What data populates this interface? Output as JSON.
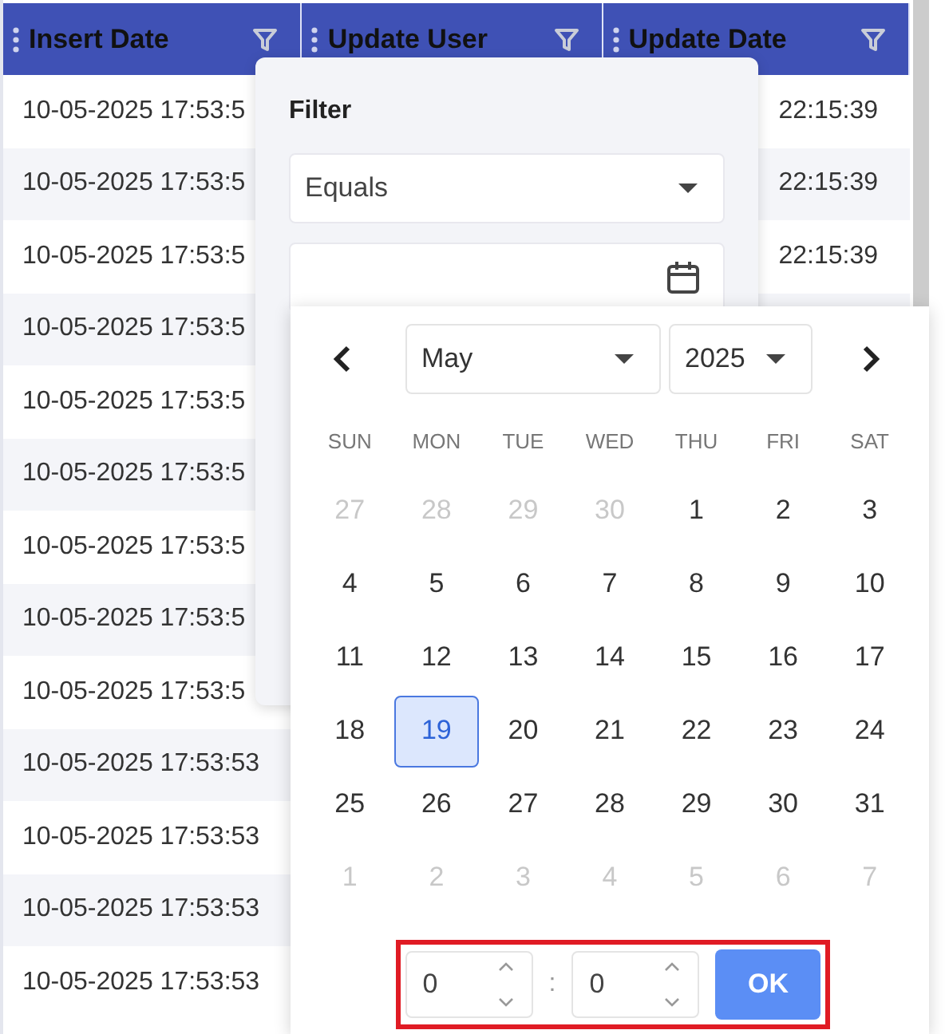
{
  "table": {
    "columns": [
      {
        "label": "Insert Date"
      },
      {
        "label": "Update User"
      },
      {
        "label": "Update Date"
      }
    ],
    "rows": [
      {
        "insert_date": "10-05-2025 17:53:5",
        "update_date": "22:15:39"
      },
      {
        "insert_date": "10-05-2025 17:53:5",
        "update_date": "22:15:39"
      },
      {
        "insert_date": "10-05-2025 17:53:5",
        "update_date": "22:15:39"
      },
      {
        "insert_date": "10-05-2025 17:53:5"
      },
      {
        "insert_date": "10-05-2025 17:53:5"
      },
      {
        "insert_date": "10-05-2025 17:53:5"
      },
      {
        "insert_date": "10-05-2025 17:53:5"
      },
      {
        "insert_date": "10-05-2025 17:53:5"
      },
      {
        "insert_date": "10-05-2025 17:53:5"
      },
      {
        "insert_date": "10-05-2025 17:53:53"
      },
      {
        "insert_date": "10-05-2025 17:53:53"
      },
      {
        "insert_date": "10-05-2025 17:53:53"
      },
      {
        "insert_date": "10-05-2025 17:53:53"
      }
    ]
  },
  "filter": {
    "title": "Filter",
    "operator": "Equals"
  },
  "calendar": {
    "month": "May",
    "year": "2025",
    "weekdays": [
      "SUN",
      "MON",
      "TUE",
      "WED",
      "THU",
      "FRI",
      "SAT"
    ],
    "weeks": [
      [
        {
          "label": "27",
          "outside": true,
          "selected": false
        },
        {
          "label": "28",
          "outside": true,
          "selected": false
        },
        {
          "label": "29",
          "outside": true,
          "selected": false
        },
        {
          "label": "30",
          "outside": true,
          "selected": false
        },
        {
          "label": "1",
          "outside": false,
          "selected": false
        },
        {
          "label": "2",
          "outside": false,
          "selected": false
        },
        {
          "label": "3",
          "outside": false,
          "selected": false
        }
      ],
      [
        {
          "label": "4",
          "outside": false,
          "selected": false
        },
        {
          "label": "5",
          "outside": false,
          "selected": false
        },
        {
          "label": "6",
          "outside": false,
          "selected": false
        },
        {
          "label": "7",
          "outside": false,
          "selected": false
        },
        {
          "label": "8",
          "outside": false,
          "selected": false
        },
        {
          "label": "9",
          "outside": false,
          "selected": false
        },
        {
          "label": "10",
          "outside": false,
          "selected": false
        }
      ],
      [
        {
          "label": "11",
          "outside": false,
          "selected": false
        },
        {
          "label": "12",
          "outside": false,
          "selected": false
        },
        {
          "label": "13",
          "outside": false,
          "selected": false
        },
        {
          "label": "14",
          "outside": false,
          "selected": false
        },
        {
          "label": "15",
          "outside": false,
          "selected": false
        },
        {
          "label": "16",
          "outside": false,
          "selected": false
        },
        {
          "label": "17",
          "outside": false,
          "selected": false
        }
      ],
      [
        {
          "label": "18",
          "outside": false,
          "selected": false
        },
        {
          "label": "19",
          "outside": false,
          "selected": true
        },
        {
          "label": "20",
          "outside": false,
          "selected": false
        },
        {
          "label": "21",
          "outside": false,
          "selected": false
        },
        {
          "label": "22",
          "outside": false,
          "selected": false
        },
        {
          "label": "23",
          "outside": false,
          "selected": false
        },
        {
          "label": "24",
          "outside": false,
          "selected": false
        }
      ],
      [
        {
          "label": "25",
          "outside": false,
          "selected": false
        },
        {
          "label": "26",
          "outside": false,
          "selected": false
        },
        {
          "label": "27",
          "outside": false,
          "selected": false
        },
        {
          "label": "28",
          "outside": false,
          "selected": false
        },
        {
          "label": "29",
          "outside": false,
          "selected": false
        },
        {
          "label": "30",
          "outside": false,
          "selected": false
        },
        {
          "label": "31",
          "outside": false,
          "selected": false
        }
      ],
      [
        {
          "label": "1",
          "outside": true,
          "selected": false
        },
        {
          "label": "2",
          "outside": true,
          "selected": false
        },
        {
          "label": "3",
          "outside": true,
          "selected": false
        },
        {
          "label": "4",
          "outside": true,
          "selected": false
        },
        {
          "label": "5",
          "outside": true,
          "selected": false
        },
        {
          "label": "6",
          "outside": true,
          "selected": false
        },
        {
          "label": "7",
          "outside": true,
          "selected": false
        }
      ]
    ],
    "time": {
      "hour": "0",
      "separator": ":",
      "minute": "0",
      "ok": "OK",
      "highlighted": true
    }
  }
}
